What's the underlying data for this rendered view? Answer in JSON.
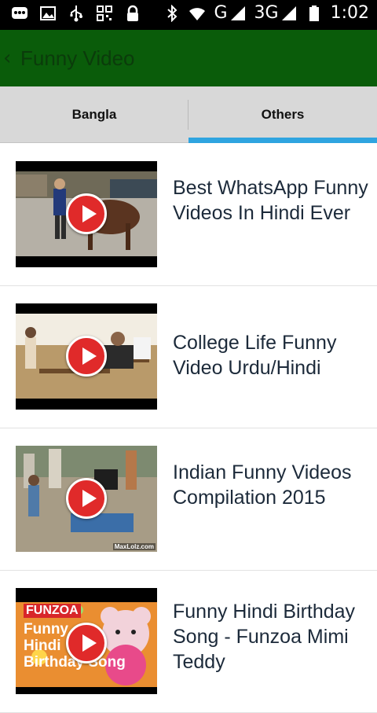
{
  "status_bar": {
    "network_g": "G",
    "network_3g": "3G",
    "time": "1:02",
    "icons": [
      "bbm-icon",
      "image-icon",
      "usb-icon",
      "qr-icon",
      "lock-icon",
      "bluetooth-icon",
      "wifi-icon",
      "signal-icon",
      "signal-icon",
      "battery-icon"
    ]
  },
  "app_bar": {
    "back_glyph": "‹",
    "title": "Funny Video"
  },
  "tabs": [
    {
      "label": "Bangla",
      "selected": false
    },
    {
      "label": "Others",
      "selected": true
    }
  ],
  "colors": {
    "app_bar": "#0a5c0a",
    "tab_indicator": "#2fa4e0",
    "play_button": "#e02a2a"
  },
  "videos": [
    {
      "title": "Best WhatsApp Funny Videos In Hindi Ever"
    },
    {
      "title": "College Life Funny Video Urdu/Hindi"
    },
    {
      "title": "Indian Funny Videos Compilation 2015",
      "thumb_watermark": "MaxLolz.com"
    },
    {
      "title": "Funny Hindi Birthday Song - Funzoa Mimi Teddy",
      "thumb_brand": "FUNZOA",
      "thumb_line1": "Funny",
      "thumb_line2": "Hindi",
      "thumb_line3": "Birthday Song"
    }
  ]
}
